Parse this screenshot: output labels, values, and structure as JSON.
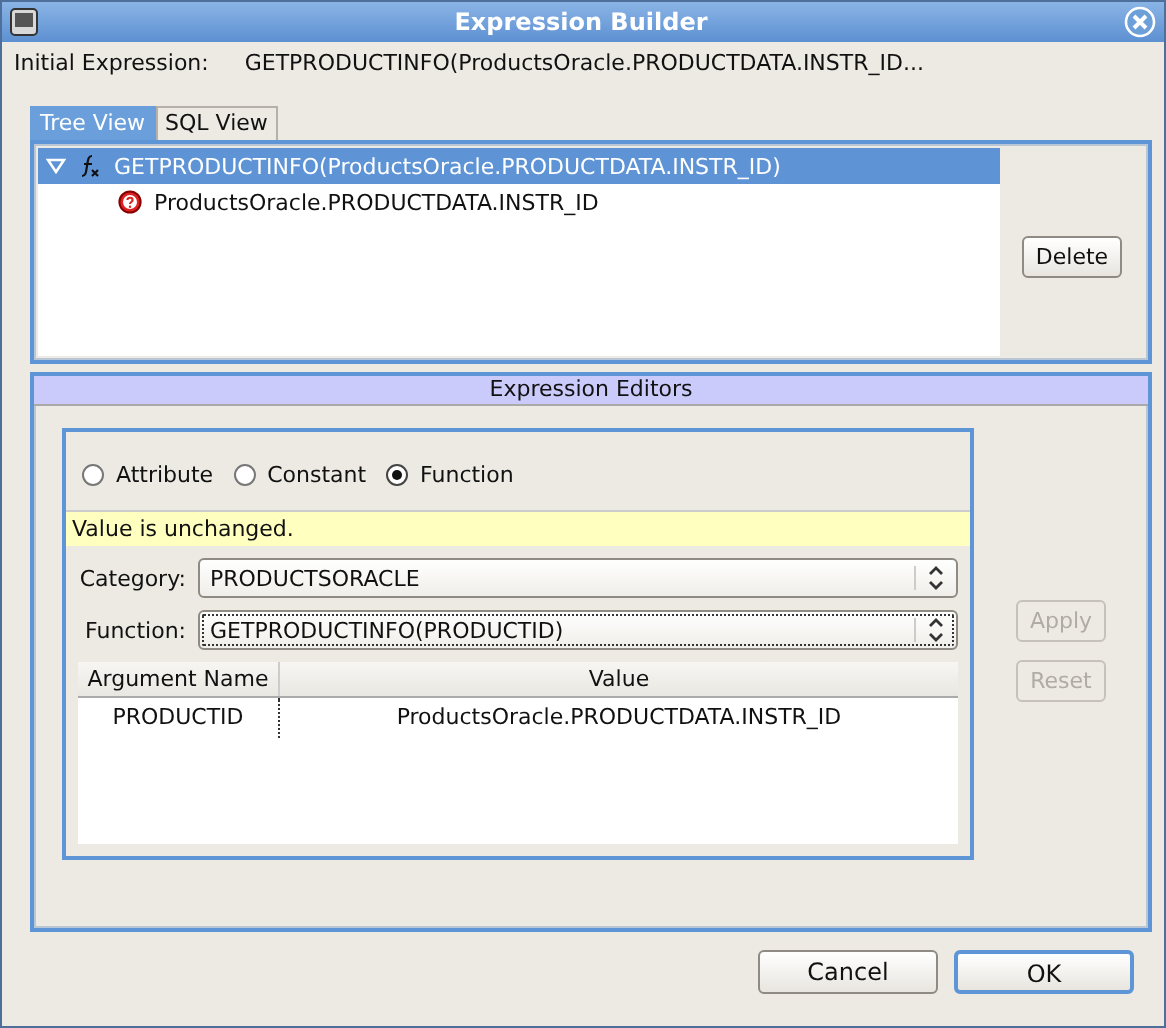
{
  "window": {
    "title": "Expression Builder"
  },
  "initial_expression": {
    "label": "Initial Expression:",
    "value": "GETPRODUCTINFO(ProductsOracle.PRODUCTDATA.INSTR_ID..."
  },
  "tabs": [
    {
      "label": "Tree View",
      "selected": true
    },
    {
      "label": "SQL View",
      "selected": false
    }
  ],
  "tree": [
    {
      "kind": "function",
      "label": "GETPRODUCTINFO(ProductsOracle.PRODUCTDATA.INSTR_ID)",
      "expanded": true,
      "selected": true,
      "children": [
        {
          "kind": "attribute",
          "label": "ProductsOracle.PRODUCTDATA.INSTR_ID",
          "selected": false
        }
      ]
    }
  ],
  "tree_buttons": [
    {
      "label": "Delete",
      "disabled": false
    }
  ],
  "editors": {
    "title": "Expression Editors",
    "radios": [
      {
        "label": "Attribute",
        "selected": false
      },
      {
        "label": "Constant",
        "selected": false
      },
      {
        "label": "Function",
        "selected": true
      }
    ],
    "message": "Value is unchanged.",
    "fields": [
      {
        "label": "Category:",
        "value": "PRODUCTSORACLE",
        "focused": false
      },
      {
        "label": "Function:",
        "value": "GETPRODUCTINFO(PRODUCTID)",
        "focused": true
      }
    ],
    "table": {
      "columns": [
        "Argument Name",
        "Value"
      ],
      "rows": [
        [
          "PRODUCTID",
          "ProductsOracle.PRODUCTDATA.INSTR_ID"
        ]
      ]
    },
    "buttons": [
      {
        "label": "Apply",
        "disabled": true
      },
      {
        "label": "Reset",
        "disabled": true
      }
    ]
  },
  "buttons": [
    {
      "label": "Cancel",
      "default": false
    },
    {
      "label": "OK",
      "default": true
    }
  ]
}
